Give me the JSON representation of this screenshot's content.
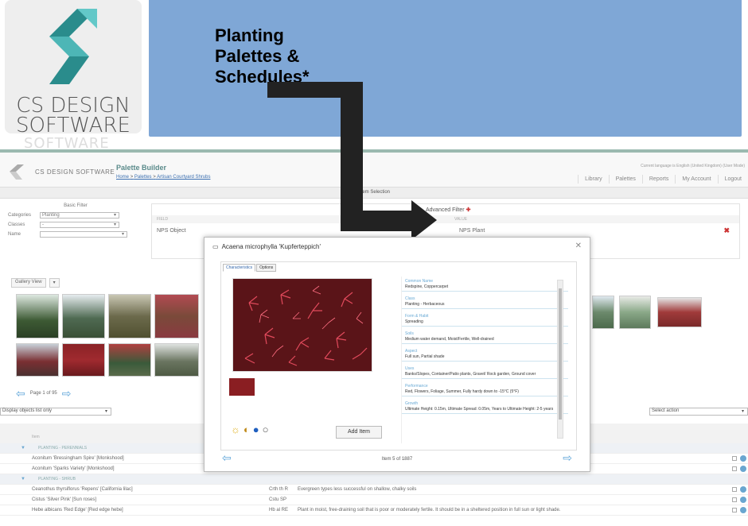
{
  "slide": {
    "logo_line1": "CS DESIGN",
    "logo_line2": "SOFTWARE",
    "ghost_text": "SOFTWARE",
    "banner_title": "Planting Palettes & Schedules*"
  },
  "app": {
    "brand": "CS DESIGN SOFTWARE",
    "title": "Palette Builder",
    "breadcrumb_home": "Home",
    "breadcrumb_palettes": "Palettes",
    "breadcrumb_current": "Artisan Courtyard Shrubs",
    "language_line": "Current language is English (United Kingdom) (User Mode)",
    "nav": [
      "Library",
      "Palettes",
      "Reports",
      "My Account",
      "Logout"
    ],
    "filter_tab": "Item Selection",
    "basic_filter": {
      "header": "Basic Filter",
      "categories_label": "Categories",
      "categories_value": "Planting",
      "classes_label": "Classes",
      "classes_value": "-",
      "name_label": "Name"
    },
    "advanced_filter": {
      "header": "Advanced Filter",
      "col_field": "FIELD",
      "col_value": "VALUE",
      "field": "NPS Object",
      "value": "NPS Plant"
    },
    "gallery_view_label": "Gallery View",
    "pager_text": "Page 1 of 95",
    "list_mode": "Display objects list only",
    "select_action": "Select action",
    "grid_header": "Item",
    "rows": [
      {
        "type": "group",
        "c1": "PLANTING - PERENNIALS"
      },
      {
        "type": "item",
        "c1": "Aconitum 'Bressingham Spire' [Monkshood]",
        "c2": "",
        "c3": ""
      },
      {
        "type": "item",
        "c1": "Aconitum 'Sparks Variety' [Monkshood]",
        "c2": "",
        "c3": ""
      },
      {
        "type": "group",
        "c1": "PLANTING - SHRUB"
      },
      {
        "type": "item",
        "c1": "Ceanothus thyrsiflorus 'Repens' [California lilac]",
        "c2": "Crth th R",
        "c3": "Evergreen types less successful on shallow, chalky soils"
      },
      {
        "type": "item",
        "c1": "Cistus 'Silver Pink' [Sun roses]",
        "c2": "Cstu SP",
        "c3": ""
      },
      {
        "type": "item",
        "c1": "Hebe albicans 'Red Edge' [Red edge hebe]",
        "c2": "Hb al RE",
        "c3": "Plant in moist, free-draining soil that is poor or moderately fertile. It should be in a sheltered position in full sun or light shade."
      }
    ]
  },
  "modal": {
    "title": "Acaena microphylla 'Kupferteppich'",
    "tab_characteristics": "Characteristics",
    "tab_options": "Options",
    "add_button": "Add Item",
    "counter": "Item 5 of 1887",
    "attributes": [
      {
        "k": "Common Name",
        "v": "Redspine, Coppercarpet"
      },
      {
        "k": "Class",
        "v": "Planting - Herbaceous"
      },
      {
        "k": "Form & Habit",
        "v": "Spreading"
      },
      {
        "k": "Soils",
        "v": "Medium water demand, Moist/Fertile, Well-drained"
      },
      {
        "k": "Aspect",
        "v": "Full sun, Partial shade"
      },
      {
        "k": "Uses",
        "v": "Banks/Slopes, Container/Patio plants, Gravel/ Rock garden, Ground cover"
      },
      {
        "k": "Performance",
        "v": "Red, Flowers, Foliage, Summer, Fully hardy down to -15°C (5°F)"
      },
      {
        "k": "Growth",
        "v": "Ultimate Height: 0.15m, Ultimate Spread: 0.05m, Years to Ultimate Height: 2-5 years"
      }
    ]
  },
  "colors": {
    "accent": "#7fa7d6",
    "link": "#3b6fb0",
    "attr_key": "#6aaad5"
  }
}
